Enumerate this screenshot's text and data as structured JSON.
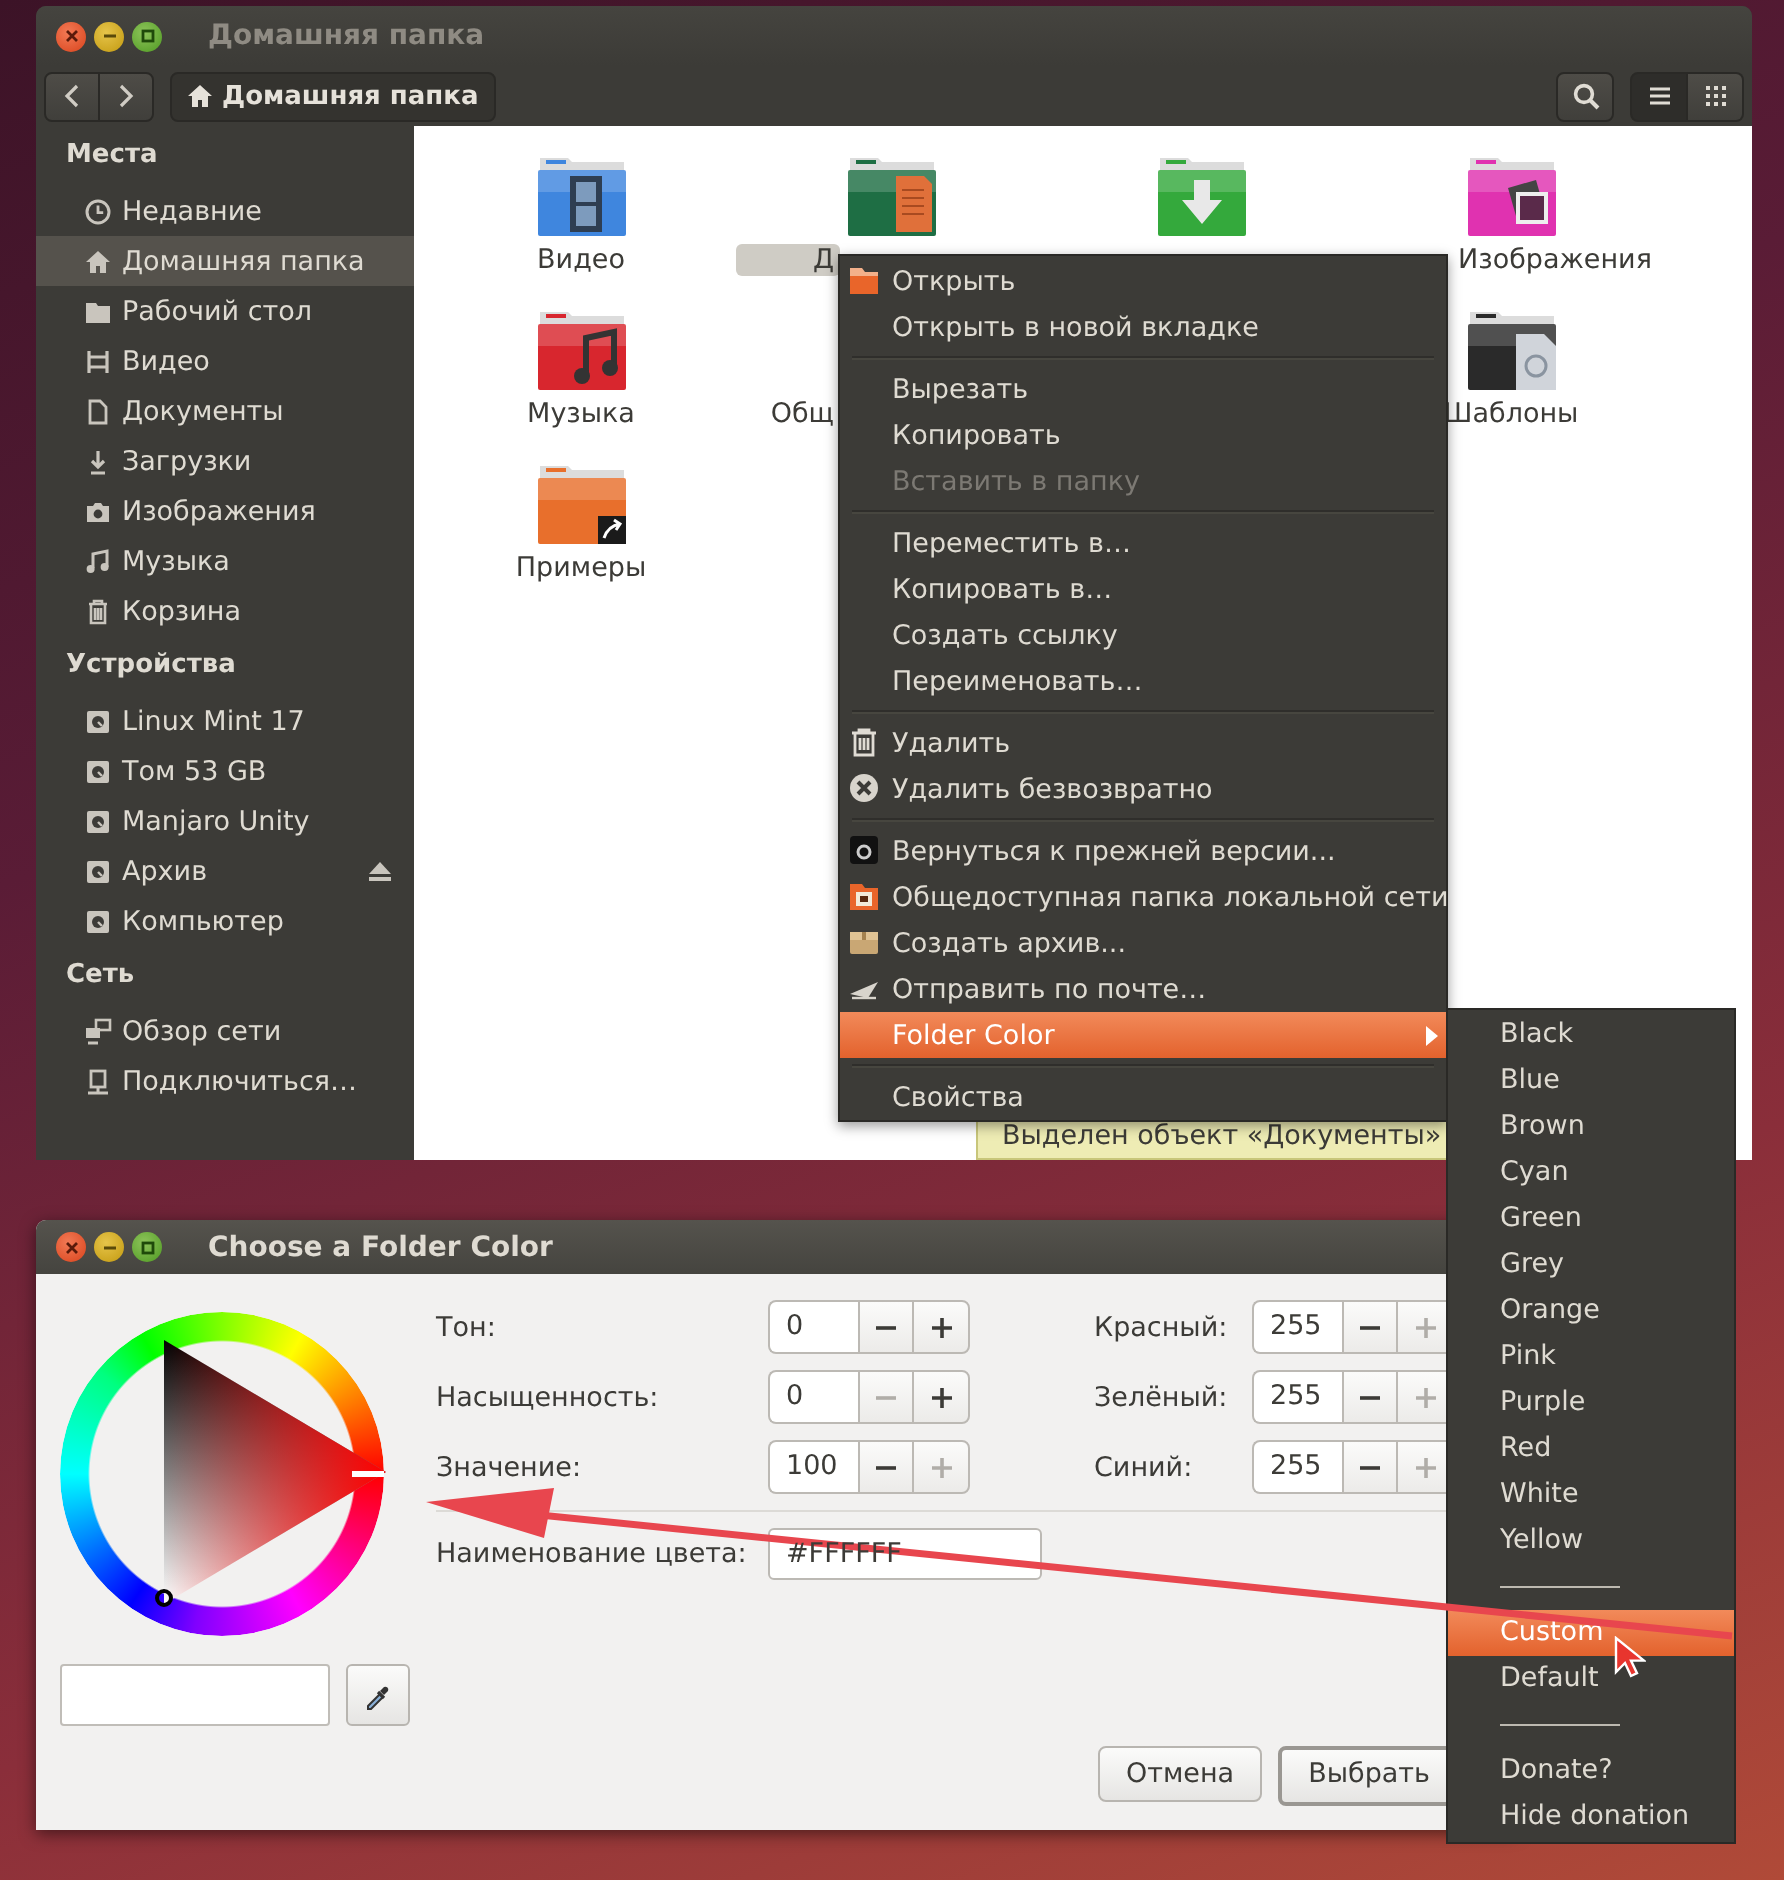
{
  "file_window": {
    "title": "Домашняя папка",
    "path": "Домашняя папка",
    "toolbar_buttons": [
      {
        "kind": "search",
        "selected": false
      },
      {
        "kind": "list",
        "selected": true
      },
      {
        "kind": "grid",
        "selected": false
      }
    ],
    "sidebar": [
      {
        "title": "Места",
        "items": [
          {
            "label": "Недавние",
            "selected": false,
            "ejectable": false
          },
          {
            "label": "Домашняя папка",
            "selected": true,
            "ejectable": false
          },
          {
            "label": "Рабочий стол",
            "selected": false,
            "ejectable": false
          },
          {
            "label": "Видео",
            "selected": false,
            "ejectable": false
          },
          {
            "label": "Документы",
            "selected": false,
            "ejectable": false
          },
          {
            "label": "Загрузки",
            "selected": false,
            "ejectable": false
          },
          {
            "label": "Изображения",
            "selected": false,
            "ejectable": false
          },
          {
            "label": "Музыка",
            "selected": false,
            "ejectable": false
          },
          {
            "label": "Корзина",
            "selected": false,
            "ejectable": false
          }
        ]
      },
      {
        "title": "Устройства",
        "items": [
          {
            "label": "Linux Mint 17",
            "selected": false,
            "ejectable": false
          },
          {
            "label": "Том 53 GB",
            "selected": false,
            "ejectable": false
          },
          {
            "label": "Manjaro Unity",
            "selected": false,
            "ejectable": false
          },
          {
            "label": "Архив",
            "selected": false,
            "ejectable": true
          },
          {
            "label": "Компьютер",
            "selected": false,
            "ejectable": false
          }
        ]
      },
      {
        "title": "Сеть",
        "items": [
          {
            "label": "Обзор сети",
            "selected": false,
            "ejectable": false
          },
          {
            "label": "Подключиться…",
            "selected": false,
            "ejectable": false
          }
        ]
      }
    ],
    "folder_rows": [
      {
        "items": [
          {
            "kind": "video",
            "label": "Видео",
            "color": "#3f86de",
            "selected": false
          },
          {
            "kind": "documents",
            "label": "Д",
            "color": "#1e6e44",
            "selected": true
          },
          {
            "kind": "downloads",
            "color": "#34a93c"
          },
          {
            "kind": "pictures",
            "label": "Изображения",
            "color": "#e032b0",
            "selected": false
          }
        ]
      },
      {
        "items": [
          {
            "kind": "music",
            "label": "Музыка",
            "color": "#d8262e",
            "selected": false
          },
          {
            "label": "Общ",
            "selected": false
          },
          {
            "kind": "templates",
            "label": "Шаблоны",
            "color": "#2a2a2a",
            "selected": false
          }
        ]
      },
      {
        "items": [
          {
            "kind": "examples",
            "label": "Примеры",
            "color": "#e86f2c",
            "selected": false
          }
        ]
      }
    ],
    "status": "Выделен объект «Документы»"
  },
  "context_menu": [
    {
      "kind": "item",
      "label": "Открыть",
      "disabled": false,
      "selected": false,
      "submenu": false
    },
    {
      "kind": "item",
      "label": "Открыть в новой вкладке",
      "disabled": false,
      "selected": false,
      "submenu": false
    },
    {
      "kind": "separator"
    },
    {
      "kind": "item",
      "label": "Вырезать",
      "disabled": false,
      "selected": false,
      "submenu": false
    },
    {
      "kind": "item",
      "label": "Копировать",
      "disabled": false,
      "selected": false,
      "submenu": false
    },
    {
      "kind": "item",
      "label": "Вставить в папку",
      "disabled": true,
      "selected": false,
      "submenu": false
    },
    {
      "kind": "separator"
    },
    {
      "kind": "item",
      "label": "Переместить в…",
      "disabled": false,
      "selected": false,
      "submenu": false
    },
    {
      "kind": "item",
      "label": "Копировать в…",
      "disabled": false,
      "selected": false,
      "submenu": false
    },
    {
      "kind": "item",
      "label": "Создать ссылку",
      "disabled": false,
      "selected": false,
      "submenu": false
    },
    {
      "kind": "item",
      "label": "Переименовать…",
      "disabled": false,
      "selected": false,
      "submenu": false
    },
    {
      "kind": "separator"
    },
    {
      "kind": "item",
      "label": "Удалить",
      "disabled": false,
      "selected": false,
      "submenu": false
    },
    {
      "kind": "item",
      "label": "Удалить безвозвратно",
      "disabled": false,
      "selected": false,
      "submenu": false
    },
    {
      "kind": "separator"
    },
    {
      "kind": "item",
      "label": "Вернуться к прежней версии...",
      "disabled": false,
      "selected": false,
      "submenu": false
    },
    {
      "kind": "item",
      "label": "Общедоступная папка локальной сети",
      "disabled": false,
      "selected": false,
      "submenu": false
    },
    {
      "kind": "item",
      "label": "Создать архив...",
      "disabled": false,
      "selected": false,
      "submenu": false
    },
    {
      "kind": "item",
      "label": "Отправить по почте…",
      "disabled": false,
      "selected": false,
      "submenu": false
    },
    {
      "kind": "item",
      "label": "Folder Color",
      "disabled": false,
      "selected": true,
      "submenu": true
    },
    {
      "kind": "separator"
    },
    {
      "kind": "item",
      "label": "Свойства",
      "disabled": false,
      "selected": false,
      "submenu": false
    }
  ],
  "color_submenu": [
    {
      "kind": "item",
      "label": "Black",
      "selected": false
    },
    {
      "kind": "item",
      "label": "Blue",
      "selected": false
    },
    {
      "kind": "item",
      "label": "Brown",
      "selected": false
    },
    {
      "kind": "item",
      "label": "Cyan",
      "selected": false
    },
    {
      "kind": "item",
      "label": "Green",
      "selected": false
    },
    {
      "kind": "item",
      "label": "Grey",
      "selected": false
    },
    {
      "kind": "item",
      "label": "Orange",
      "selected": false
    },
    {
      "kind": "item",
      "label": "Pink",
      "selected": false
    },
    {
      "kind": "item",
      "label": "Purple",
      "selected": false
    },
    {
      "kind": "item",
      "label": "Red",
      "selected": false
    },
    {
      "kind": "item",
      "label": "White",
      "selected": false
    },
    {
      "kind": "item",
      "label": "Yellow",
      "selected": false
    },
    {
      "kind": "separator"
    },
    {
      "kind": "item",
      "label": "Custom",
      "selected": true
    },
    {
      "kind": "item",
      "label": "Default",
      "selected": false
    },
    {
      "kind": "separator"
    },
    {
      "kind": "item",
      "label": "Donate?",
      "selected": false
    },
    {
      "kind": "item",
      "label": "Hide donation",
      "selected": false
    }
  ],
  "color_dialog": {
    "title": "Choose a Folder Color",
    "rows": [
      {
        "left": {
          "label": "Тон:",
          "value": "0",
          "minus_disabled": false,
          "plus_disabled": false
        },
        "right": {
          "label": "Красный:",
          "value": "255",
          "minus_disabled": false,
          "plus_disabled": true
        }
      },
      {
        "left": {
          "label": "Насыщенность:",
          "value": "0",
          "minus_disabled": true,
          "plus_disabled": false
        },
        "right": {
          "label": "Зелёный:",
          "value": "255",
          "minus_disabled": false,
          "plus_disabled": true
        }
      },
      {
        "left": {
          "label": "Значение:",
          "value": "100",
          "minus_disabled": false,
          "plus_disabled": true
        },
        "right": {
          "label": "Синий:",
          "value": "255",
          "minus_disabled": false,
          "plus_disabled": true
        }
      }
    ],
    "color_name": {
      "label": "Наименование цвета:",
      "value": "#FFFFFF"
    },
    "buttons": [
      {
        "label": "Отмена",
        "default": false
      },
      {
        "label": "Выбрать",
        "default": true
      }
    ]
  }
}
